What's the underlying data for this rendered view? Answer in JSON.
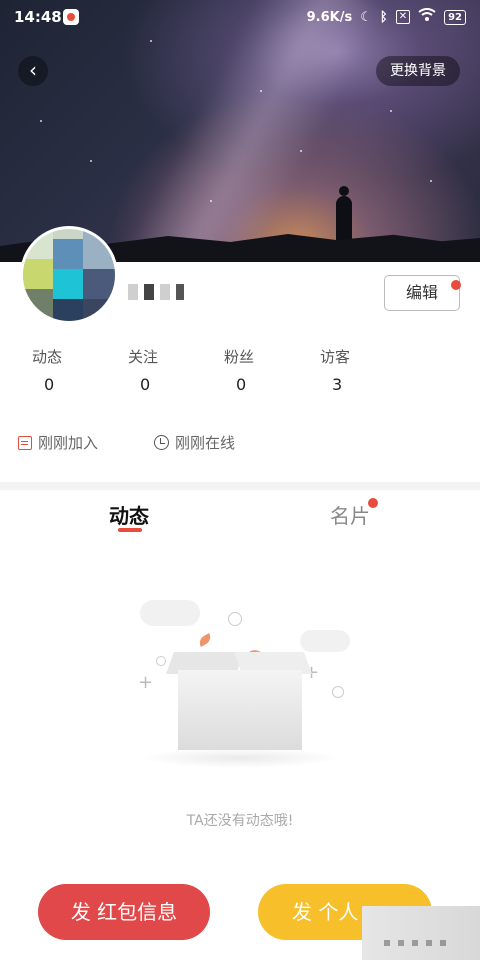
{
  "status_bar": {
    "time": "14:48",
    "network_speed": "9.6K/s",
    "battery": "92",
    "icons": [
      "app-icon",
      "moon-icon",
      "bluetooth-icon",
      "sim-x-icon",
      "wifi-icon",
      "battery-icon"
    ]
  },
  "header": {
    "back_icon": "chevron-left-icon",
    "change_background_label": "更换背景"
  },
  "profile": {
    "edit_label": "编辑",
    "stats": [
      {
        "label": "动态",
        "value": "0"
      },
      {
        "label": "关注",
        "value": "0"
      },
      {
        "label": "粉丝",
        "value": "0"
      },
      {
        "label": "访客",
        "value": "3"
      }
    ],
    "joined_text": "刚刚加入",
    "online_text": "刚刚在线"
  },
  "tabs": [
    {
      "label": "动态",
      "active": true
    },
    {
      "label": "名片",
      "active": false,
      "has_dot": true
    }
  ],
  "empty_state": {
    "message": "TA还没有动态哦!"
  },
  "actions": {
    "red_packet_label": "发 红包信息",
    "personal_label": "发 个人"
  },
  "colors": {
    "accent_red": "#e0484a",
    "accent_yellow": "#f7c02b",
    "tab_indicator": "#e74c3c"
  }
}
